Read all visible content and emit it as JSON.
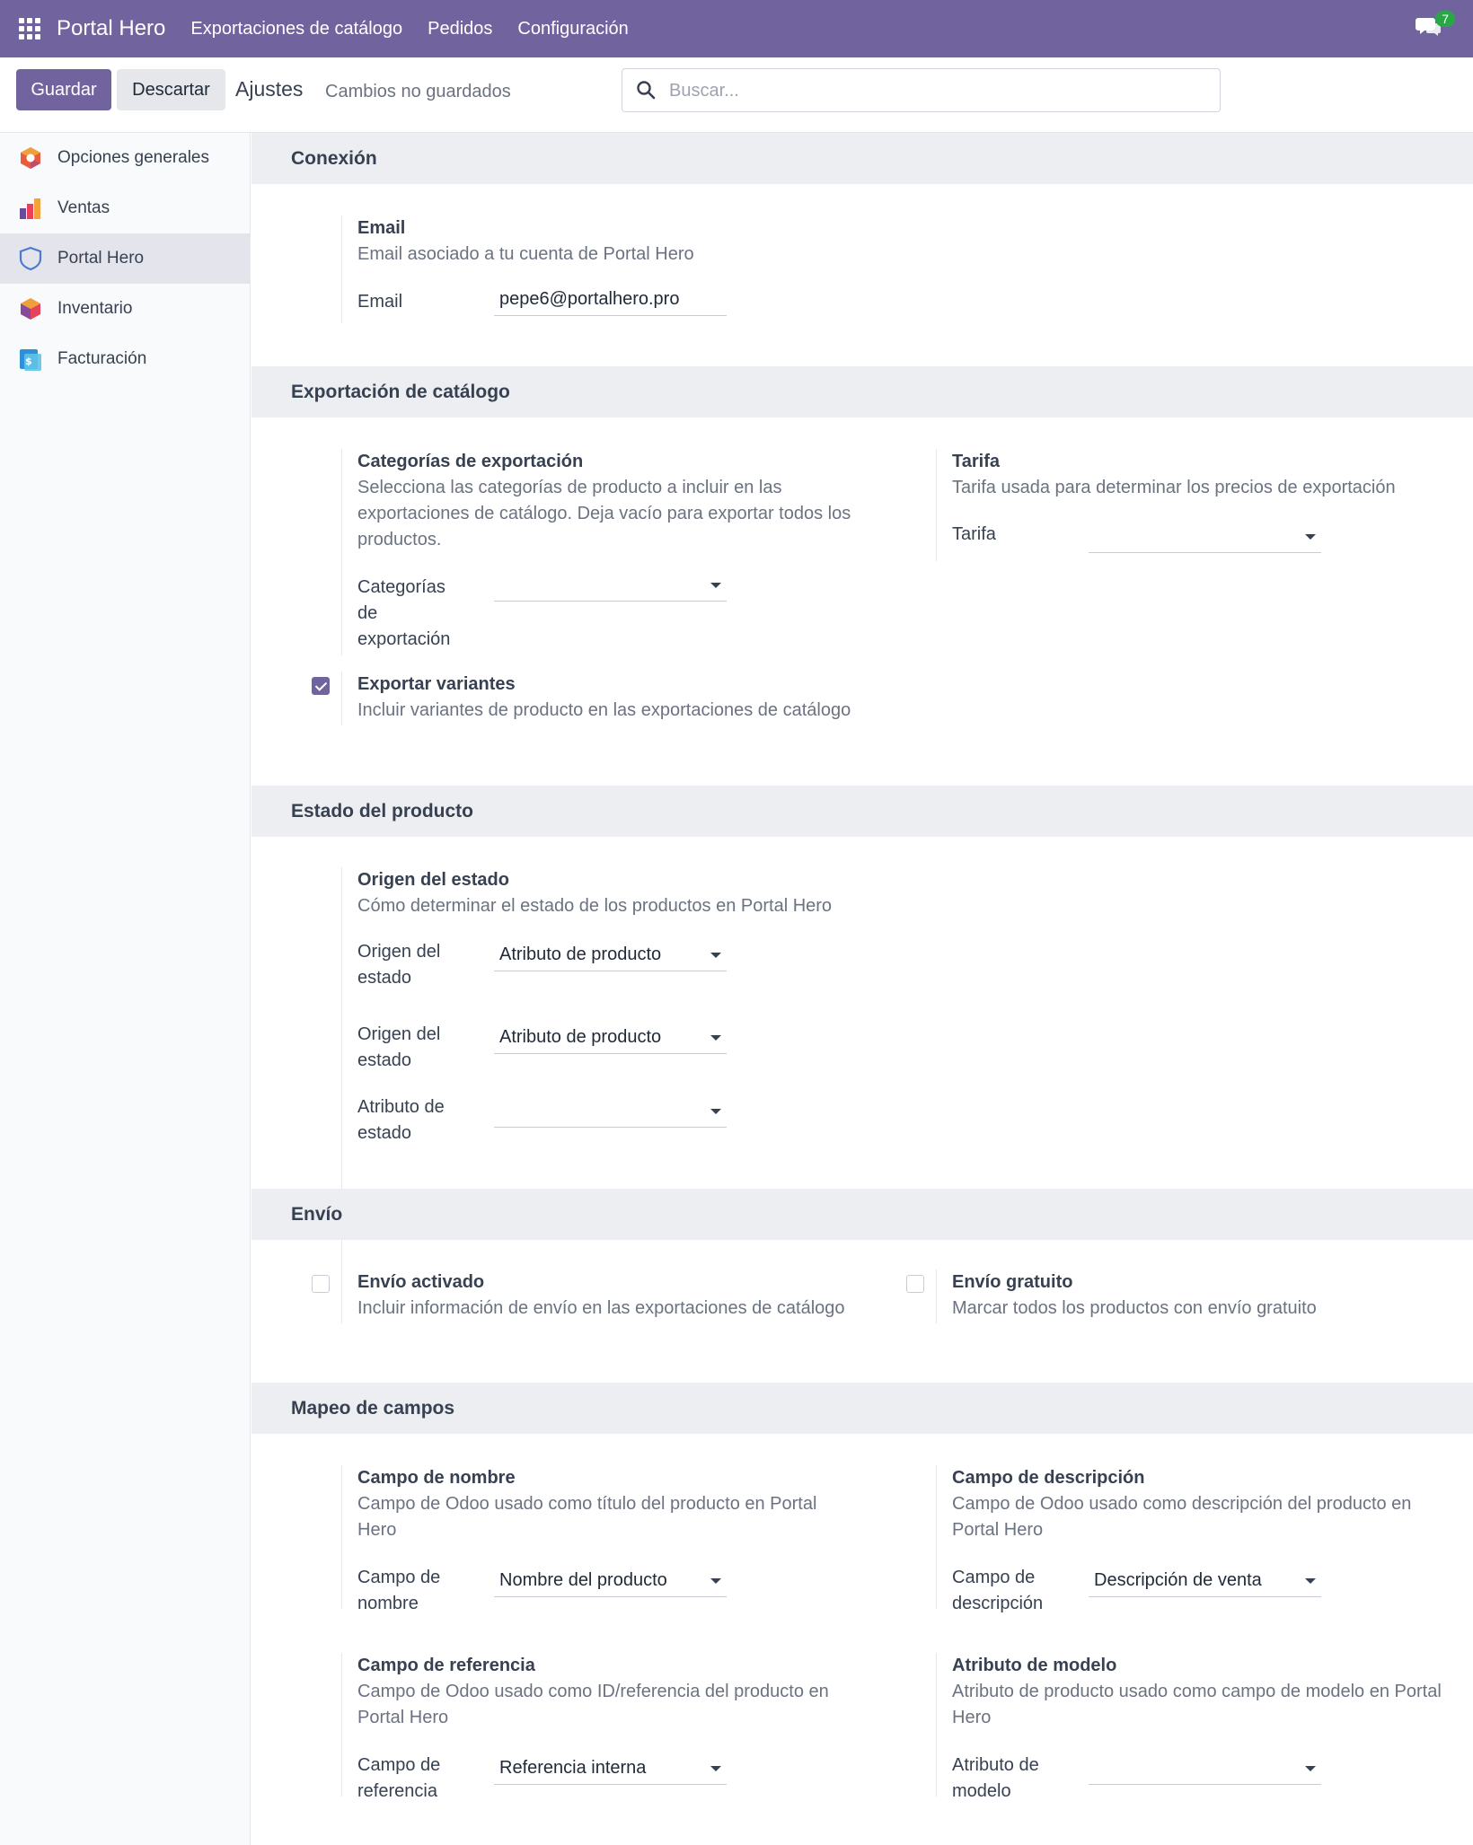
{
  "navbar": {
    "brand": "Portal Hero",
    "menu": [
      "Exportaciones de catálogo",
      "Pedidos",
      "Configuración"
    ],
    "messages_count": "7"
  },
  "control_panel": {
    "save_label": "Guardar",
    "discard_label": "Descartar",
    "title": "Ajustes",
    "unsaved": "Cambios no guardados",
    "search_placeholder": "Buscar..."
  },
  "sidebar": {
    "items": [
      {
        "label": "Opciones generales",
        "icon": "general-settings-icon"
      },
      {
        "label": "Ventas",
        "icon": "sales-icon"
      },
      {
        "label": "Portal Hero",
        "icon": "portal-hero-shield-icon",
        "active": true
      },
      {
        "label": "Inventario",
        "icon": "inventory-icon"
      },
      {
        "label": "Facturación",
        "icon": "invoicing-icon"
      }
    ]
  },
  "sections": {
    "connection": {
      "title": "Conexión",
      "email": {
        "title": "Email",
        "desc": "Email asociado a tu cuenta de Portal Hero",
        "label": "Email",
        "value": "pepe6@portalhero.pro"
      }
    },
    "catalog_export": {
      "title": "Exportación de catálogo",
      "categories": {
        "title": "Categorías de exportación",
        "desc": "Selecciona las categorías de producto a incluir en las exportaciones de catálogo. Deja vacío para exportar todos los productos.",
        "label": "Categorías de exportación",
        "value": ""
      },
      "pricelist": {
        "title": "Tarifa",
        "desc": "Tarifa usada para determinar los precios de exportación",
        "label": "Tarifa",
        "value": ""
      },
      "variants": {
        "title": "Exportar variantes",
        "desc": "Incluir variantes de producto en las exportaciones de catálogo",
        "checked": true
      }
    },
    "product_state": {
      "title": "Estado del producto",
      "origin": {
        "title": "Origen del estado",
        "desc": "Cómo determinar el estado de los productos en Portal Hero",
        "label1": "Origen del estado",
        "value1": "Atributo de producto",
        "label2": "Origen del estado",
        "value2": "Atributo de producto",
        "label3": "Atributo de estado",
        "value3": ""
      }
    },
    "shipping": {
      "title": "Envío",
      "enabled": {
        "title": "Envío activado",
        "desc": "Incluir información de envío en las exportaciones de catálogo",
        "checked": false
      },
      "free": {
        "title": "Envío gratuito",
        "desc": "Marcar todos los productos con envío gratuito",
        "checked": false
      }
    },
    "field_mapping": {
      "title": "Mapeo de campos",
      "name": {
        "title": "Campo de nombre",
        "desc": "Campo de Odoo usado como título del producto en Portal Hero",
        "label": "Campo de nombre",
        "value": "Nombre del producto"
      },
      "description": {
        "title": "Campo de descripción",
        "desc": "Campo de Odoo usado como descripción del producto en Portal Hero",
        "label": "Campo de descripción",
        "value": "Descripción de venta"
      },
      "reference": {
        "title": "Campo de referencia",
        "desc": "Campo de Odoo usado como ID/referencia del producto en Portal Hero",
        "label": "Campo de referencia",
        "value": "Referencia interna"
      },
      "model": {
        "title": "Atributo de modelo",
        "desc": "Atributo de producto usado como campo de modelo en Portal Hero",
        "label": "Atributo de modelo",
        "value": ""
      }
    }
  }
}
